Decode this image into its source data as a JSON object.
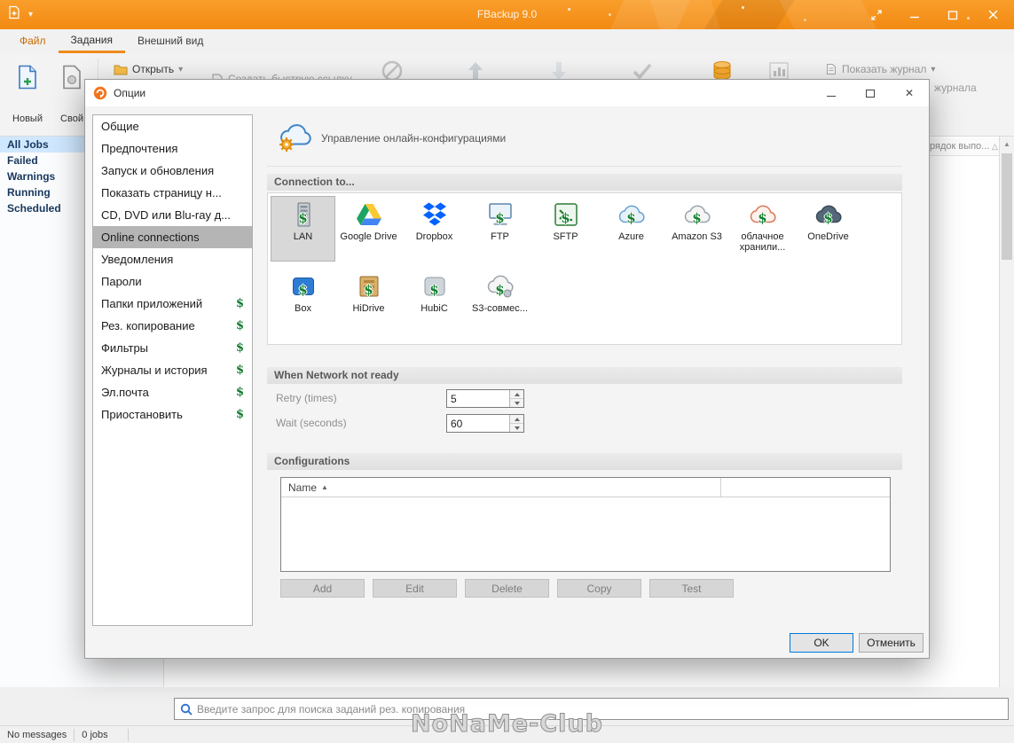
{
  "window": {
    "title": "FBackup 9.0"
  },
  "paid_symbol": "$",
  "tabs": {
    "file": "Файл",
    "jobs": "Задания",
    "view": "Внешний вид"
  },
  "ribbon": {
    "new": "Новый",
    "custom": "Свой",
    "open": "Открыть",
    "create_quick_link": "Создать быструю ссылку...",
    "show_log": "Показать журнал",
    "log_folder_partial": "журнала"
  },
  "jobs_panel": {
    "items": [
      "All Jobs",
      "Failed",
      "Warnings",
      "Running",
      "Scheduled"
    ]
  },
  "main_list": {
    "column_header_partial": "рядок выпо..."
  },
  "search": {
    "placeholder": "Введите запрос для поиска заданий рез. копирования"
  },
  "status_bar": {
    "messages": "No messages",
    "jobs": "0 jobs"
  },
  "watermark": "NoNaMe-Club",
  "dialog": {
    "title": "Опции",
    "categories": [
      {
        "label": "Общие"
      },
      {
        "label": "Предпочтения"
      },
      {
        "label": "Запуск и обновления"
      },
      {
        "label": "Показать страницу н..."
      },
      {
        "label": "CD, DVD или Blu-ray д..."
      },
      {
        "label": "Online connections",
        "selected": true
      },
      {
        "label": "Уведомления"
      },
      {
        "label": "Пароли"
      },
      {
        "label": "Папки приложений",
        "paid": true
      },
      {
        "label": "Рез. копирование",
        "paid": true
      },
      {
        "label": "Фильтры",
        "paid": true
      },
      {
        "label": "Журналы и история",
        "paid": true
      },
      {
        "label": "Эл.почта",
        "paid": true
      },
      {
        "label": "Приостановить",
        "paid": true
      }
    ],
    "header_text": "Управление онлайн-конфигурациями",
    "sections": {
      "connection": "Connection to...",
      "network": "When Network not ready",
      "configurations": "Configurations"
    },
    "connections_row1": [
      {
        "label": "LAN",
        "paid": true,
        "selected": true
      },
      {
        "label": "Google Drive",
        "paid": false
      },
      {
        "label": "Dropbox",
        "paid": false
      },
      {
        "label": "FTP",
        "paid": true
      },
      {
        "label": "SFTP",
        "paid": true
      },
      {
        "label": "Azure",
        "paid": true
      },
      {
        "label": "Amazon S3",
        "paid": true
      },
      {
        "label": "облачное хранили...",
        "paid": true
      },
      {
        "label": "OneDrive",
        "paid": true
      }
    ],
    "connections_row2": [
      {
        "label": "Box",
        "paid": true
      },
      {
        "label": "HiDrive",
        "paid": true
      },
      {
        "label": "HubiC",
        "paid": true
      },
      {
        "label": "S3-совмес...",
        "paid": true
      }
    ],
    "network": {
      "retry_label": "Retry (times)",
      "retry_value": "5",
      "wait_label": "Wait (seconds)",
      "wait_value": "60"
    },
    "table": {
      "name_header": "Name"
    },
    "buttons": [
      "Add",
      "Edit",
      "Delete",
      "Copy",
      "Test"
    ],
    "ok": "OK",
    "cancel": "Отменить"
  }
}
